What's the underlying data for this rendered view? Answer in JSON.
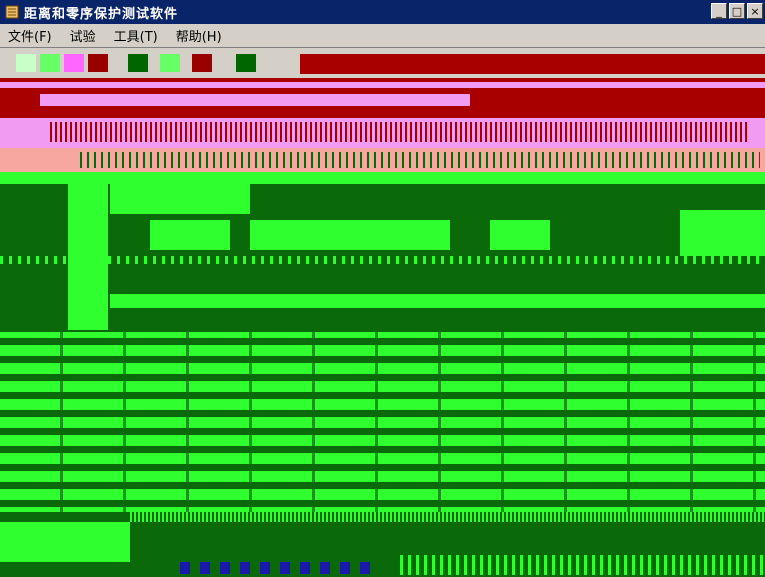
{
  "window": {
    "title": "距离和零序保护测试软件",
    "minimize_label": "_",
    "maximize_label": "□",
    "close_label": "×"
  },
  "menu": [
    {
      "label": "文件(F)"
    },
    {
      "label": "试验"
    },
    {
      "label": "工具(T)"
    },
    {
      "label": "帮助(H)"
    }
  ],
  "colors": {
    "title_bg": "#0a246a",
    "band_red": "#a80000",
    "band_pink": "#f19bf3",
    "band_salmon": "#f6a8a0",
    "band_green_bright": "#2fff2f",
    "band_green_dark": "#0a6a0a"
  }
}
